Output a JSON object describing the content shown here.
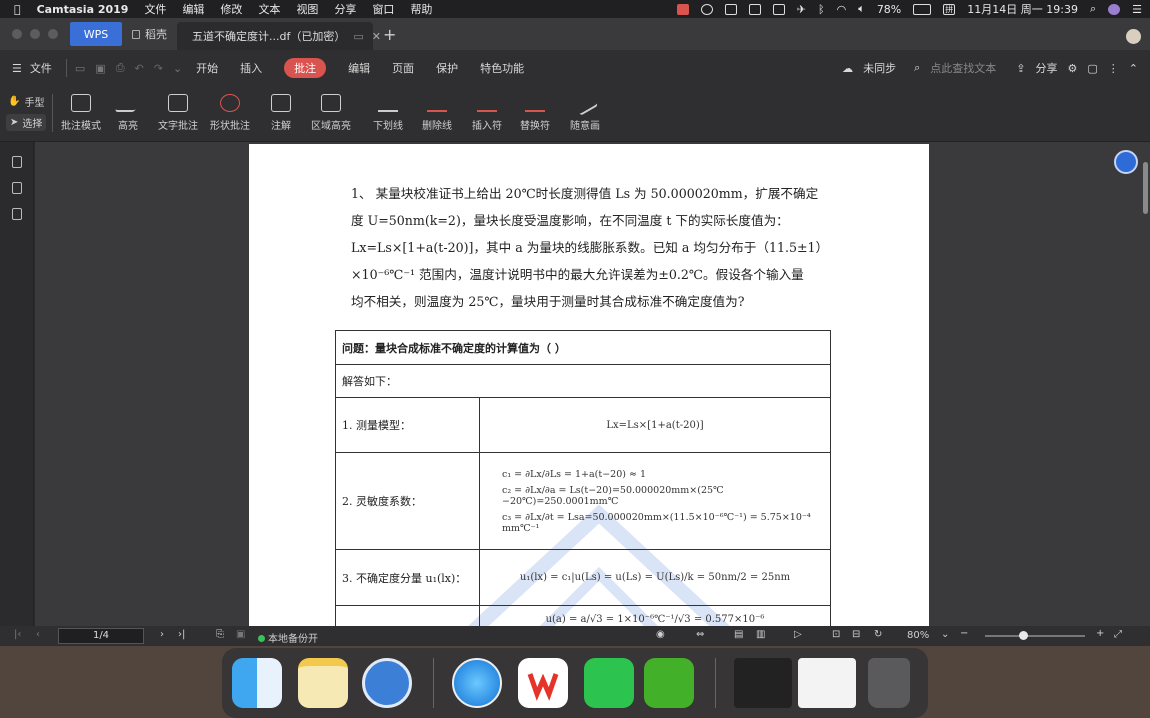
{
  "menubar": {
    "app": "Camtasia 2019",
    "items": [
      "文件",
      "编辑",
      "修改",
      "文本",
      "视图",
      "分享",
      "窗口",
      "帮助"
    ],
    "battery": "78%",
    "datetime": "11月14日 周一 19:39",
    "input_method": "拼"
  },
  "tabs": {
    "wps": "WPS",
    "daoke": "稻壳",
    "doc": "五道不确定度计...df（已加密）"
  },
  "menurow": {
    "file": "文件",
    "items": [
      "开始",
      "插入",
      "批注",
      "编辑",
      "页面",
      "保护",
      "特色功能"
    ],
    "active_index": 2,
    "sync": "未同步",
    "search_placeholder": "点此查找文本",
    "share": "分享"
  },
  "toolbar": {
    "hand": "手型",
    "select": "选择",
    "tools": [
      "批注模式",
      "高亮",
      "文字批注",
      "形状批注",
      "注解",
      "区域高亮",
      "下划线",
      "删除线",
      "插入符",
      "替换符",
      "随意画"
    ]
  },
  "document": {
    "paragraph": [
      "1、 某量块校准证书上给出 20℃时长度测得值 Ls 为 50.000020mm，扩展不确定",
      "度 U=50nm(k=2)，量块长度受温度影响，在不同温度 t 下的实际长度值为：",
      "Lx=Ls×[1+a(t-20)]，其中 a 为量块的线膨胀系数。已知 a 均匀分布于（11.5±1）",
      "×10⁻⁶℃⁻¹ 范围内，温度计说明书中的最大允许误差为±0.2℃。假设各个输入量",
      "均不相关，则温度为 25℃，量块用于测量时其合成标准不确定度值为?"
    ],
    "table": {
      "question": "问题：量块合成标准不确定度的计算值为（   ）",
      "answer_intro": "解答如下：",
      "rows": [
        {
          "label": "1. 测量模型：",
          "content": "Lx=Ls×[1+a(t-20)]"
        },
        {
          "label": "2. 灵敏度系数：",
          "lines": [
            "c₁ = ∂Lx/∂Ls = 1+a(t−20) ≈ 1",
            "c₂ = ∂Lx/∂a = Ls(t−20)=50.000020mm×(25℃−20℃)=250.0001mm℃",
            "c₃ = ∂Lx/∂t = Lsa=50.000020mm×(11.5×10⁻⁶℃⁻¹) = 5.75×10⁻⁴ mm℃⁻¹"
          ]
        },
        {
          "label": "3. 不确定度分量 u₁(lx)：",
          "content": "u₁(lx) = c₁|u(Ls) = u(Ls) = U(Ls)/k = 50nm/2 = 25nm"
        },
        {
          "label": "",
          "content": "u(a) = a/√3 = 1×10⁻⁶℃⁻¹/√3 = 0.577×10⁻⁶"
        }
      ]
    }
  },
  "statusbar": {
    "page": "1/4",
    "backup": "本地备份开",
    "zoom": "80%"
  },
  "colors": {
    "accent": "#d9534f",
    "wps_tab": "#3a6fd8"
  }
}
